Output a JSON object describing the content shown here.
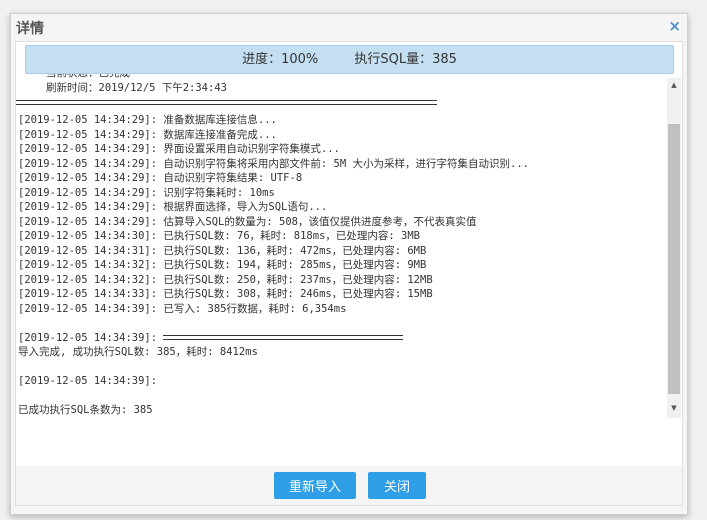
{
  "dialog": {
    "title": "详情",
    "close_icon": "×"
  },
  "progress": {
    "label": "进度：100%",
    "sql_count": "执行SQL量：385",
    "percent": 100
  },
  "status": {
    "state": "当前状态：已完成",
    "refresh_time": "刷新时间：2019/12/5 下午2:34:43"
  },
  "log": [
    "[2019-12-05 14:34:29]: 准备数据库连接信息...",
    "[2019-12-05 14:34:29]: 数据库连接准备完成...",
    "[2019-12-05 14:34:29]: 界面设置采用自动识别字符集模式...",
    "[2019-12-05 14:34:29]: 自动识别字符集将采用内部文件前: 5M 大小为采样，进行字符集自动识别...",
    "[2019-12-05 14:34:29]: 自动识别字符集结果: UTF-8",
    "[2019-12-05 14:34:29]: 识别字符集耗时: 10ms",
    "[2019-12-05 14:34:29]: 根据界面选择，导入为SQL语句...",
    "[2019-12-05 14:34:29]: 估算导入SQL的数量为: 508，该值仅提供进度参考，不代表真实值",
    "[2019-12-05 14:34:30]: 已执行SQL数: 76，耗时: 818ms，已处理内容: 3MB",
    "[2019-12-05 14:34:31]: 已执行SQL数: 136，耗时: 472ms，已处理内容: 6MB",
    "[2019-12-05 14:34:32]: 已执行SQL数: 194，耗时: 285ms，已处理内容: 9MB",
    "[2019-12-05 14:34:32]: 已执行SQL数: 250，耗时: 237ms，已处理内容: 12MB",
    "[2019-12-05 14:34:33]: 已执行SQL数: 308，耗时: 246ms，已处理内容: 15MB",
    "[2019-12-05 14:34:39]: 已写入: 385行数据，耗时: 6,354ms"
  ],
  "summary": {
    "sep_prefix": "[2019-12-05 14:34:39]: ",
    "complete": "导入完成, 成功执行SQL数: 385，耗时: 8412ms",
    "ts2": "[2019-12-05 14:34:39]:",
    "total": "已成功执行SQL条数为: 385"
  },
  "buttons": {
    "reimport": "重新导入",
    "close": "关闭"
  },
  "colors": {
    "accent": "#2e9fe6",
    "progress_bg": "#c5dff2"
  }
}
